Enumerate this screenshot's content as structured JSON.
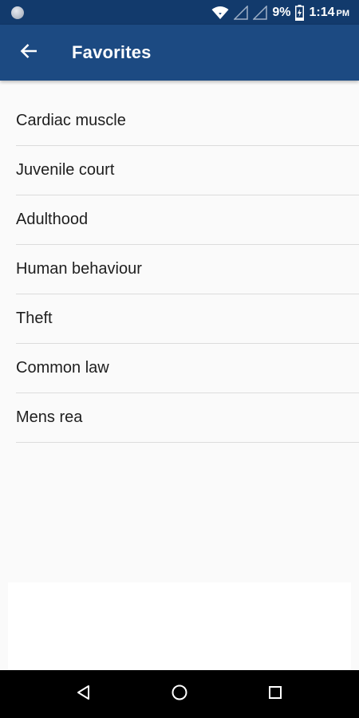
{
  "status_bar": {
    "battery_percent": "9%",
    "time": "1:14",
    "time_suffix": "PM",
    "icons": [
      "notification-dot-icon",
      "wifi-icon",
      "signal-icon",
      "signal-icon",
      "battery-charging-icon"
    ]
  },
  "app_bar": {
    "title": "Favorites",
    "back_icon": "arrow-left-icon",
    "background_color": "#1c4a82"
  },
  "favorites": {
    "items": [
      {
        "label": "Cardiac muscle"
      },
      {
        "label": "Juvenile court"
      },
      {
        "label": "Adulthood"
      },
      {
        "label": "Human behaviour"
      },
      {
        "label": "Theft"
      },
      {
        "label": "Common law"
      },
      {
        "label": "Mens rea"
      }
    ]
  },
  "nav_bar": {
    "icons": [
      "back-triangle-icon",
      "home-circle-icon",
      "recents-square-icon"
    ]
  },
  "colors": {
    "status_bar": "#123a6c",
    "app_bar": "#1c4a82",
    "background": "#fafafa",
    "divider": "#dcdcdc"
  }
}
